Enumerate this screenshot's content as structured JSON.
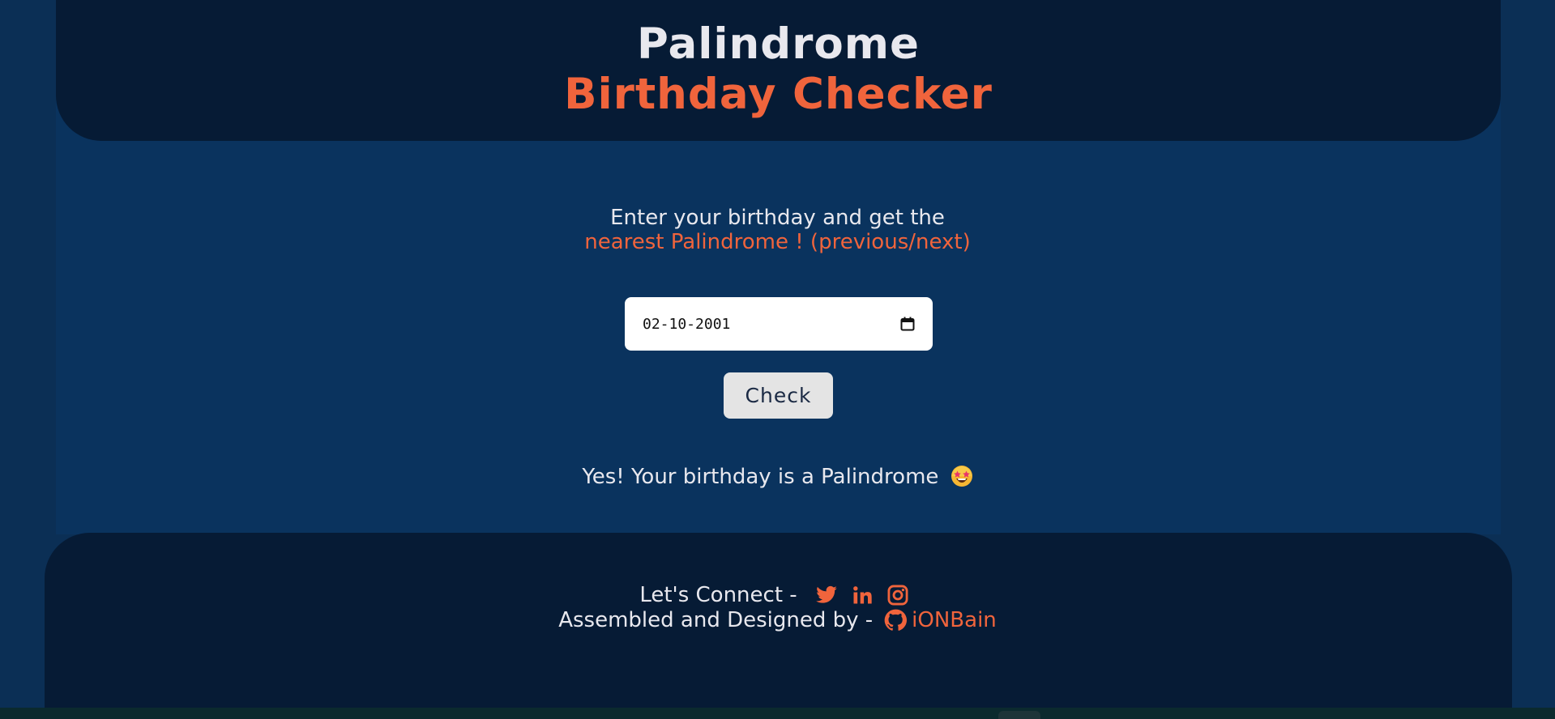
{
  "header": {
    "title_line1": "Palindrome",
    "title_line2": "Birthday Checker"
  },
  "intro": {
    "line1": "Enter your birthday and get the",
    "line2": "nearest Palindrome ! (previous/next)"
  },
  "form": {
    "date_value": "02-10-2001",
    "calendar_icon": "calendar-icon",
    "check_label": "Check"
  },
  "result": {
    "message": "Yes! Your birthday is a Palindrome",
    "emoji": "star-struck-emoji"
  },
  "footer": {
    "connect_label": "Let's Connect -",
    "social_icons": [
      "twitter-icon",
      "linkedin-icon",
      "instagram-icon"
    ],
    "assembled_label": "Assembled and Designed by -",
    "author_icon": "github-icon",
    "author_name": "iONBain"
  },
  "colors": {
    "accent": "#f0643c",
    "header_bg": "#061b35",
    "main_bg": "#0a335e",
    "text": "#e8e8ee"
  }
}
